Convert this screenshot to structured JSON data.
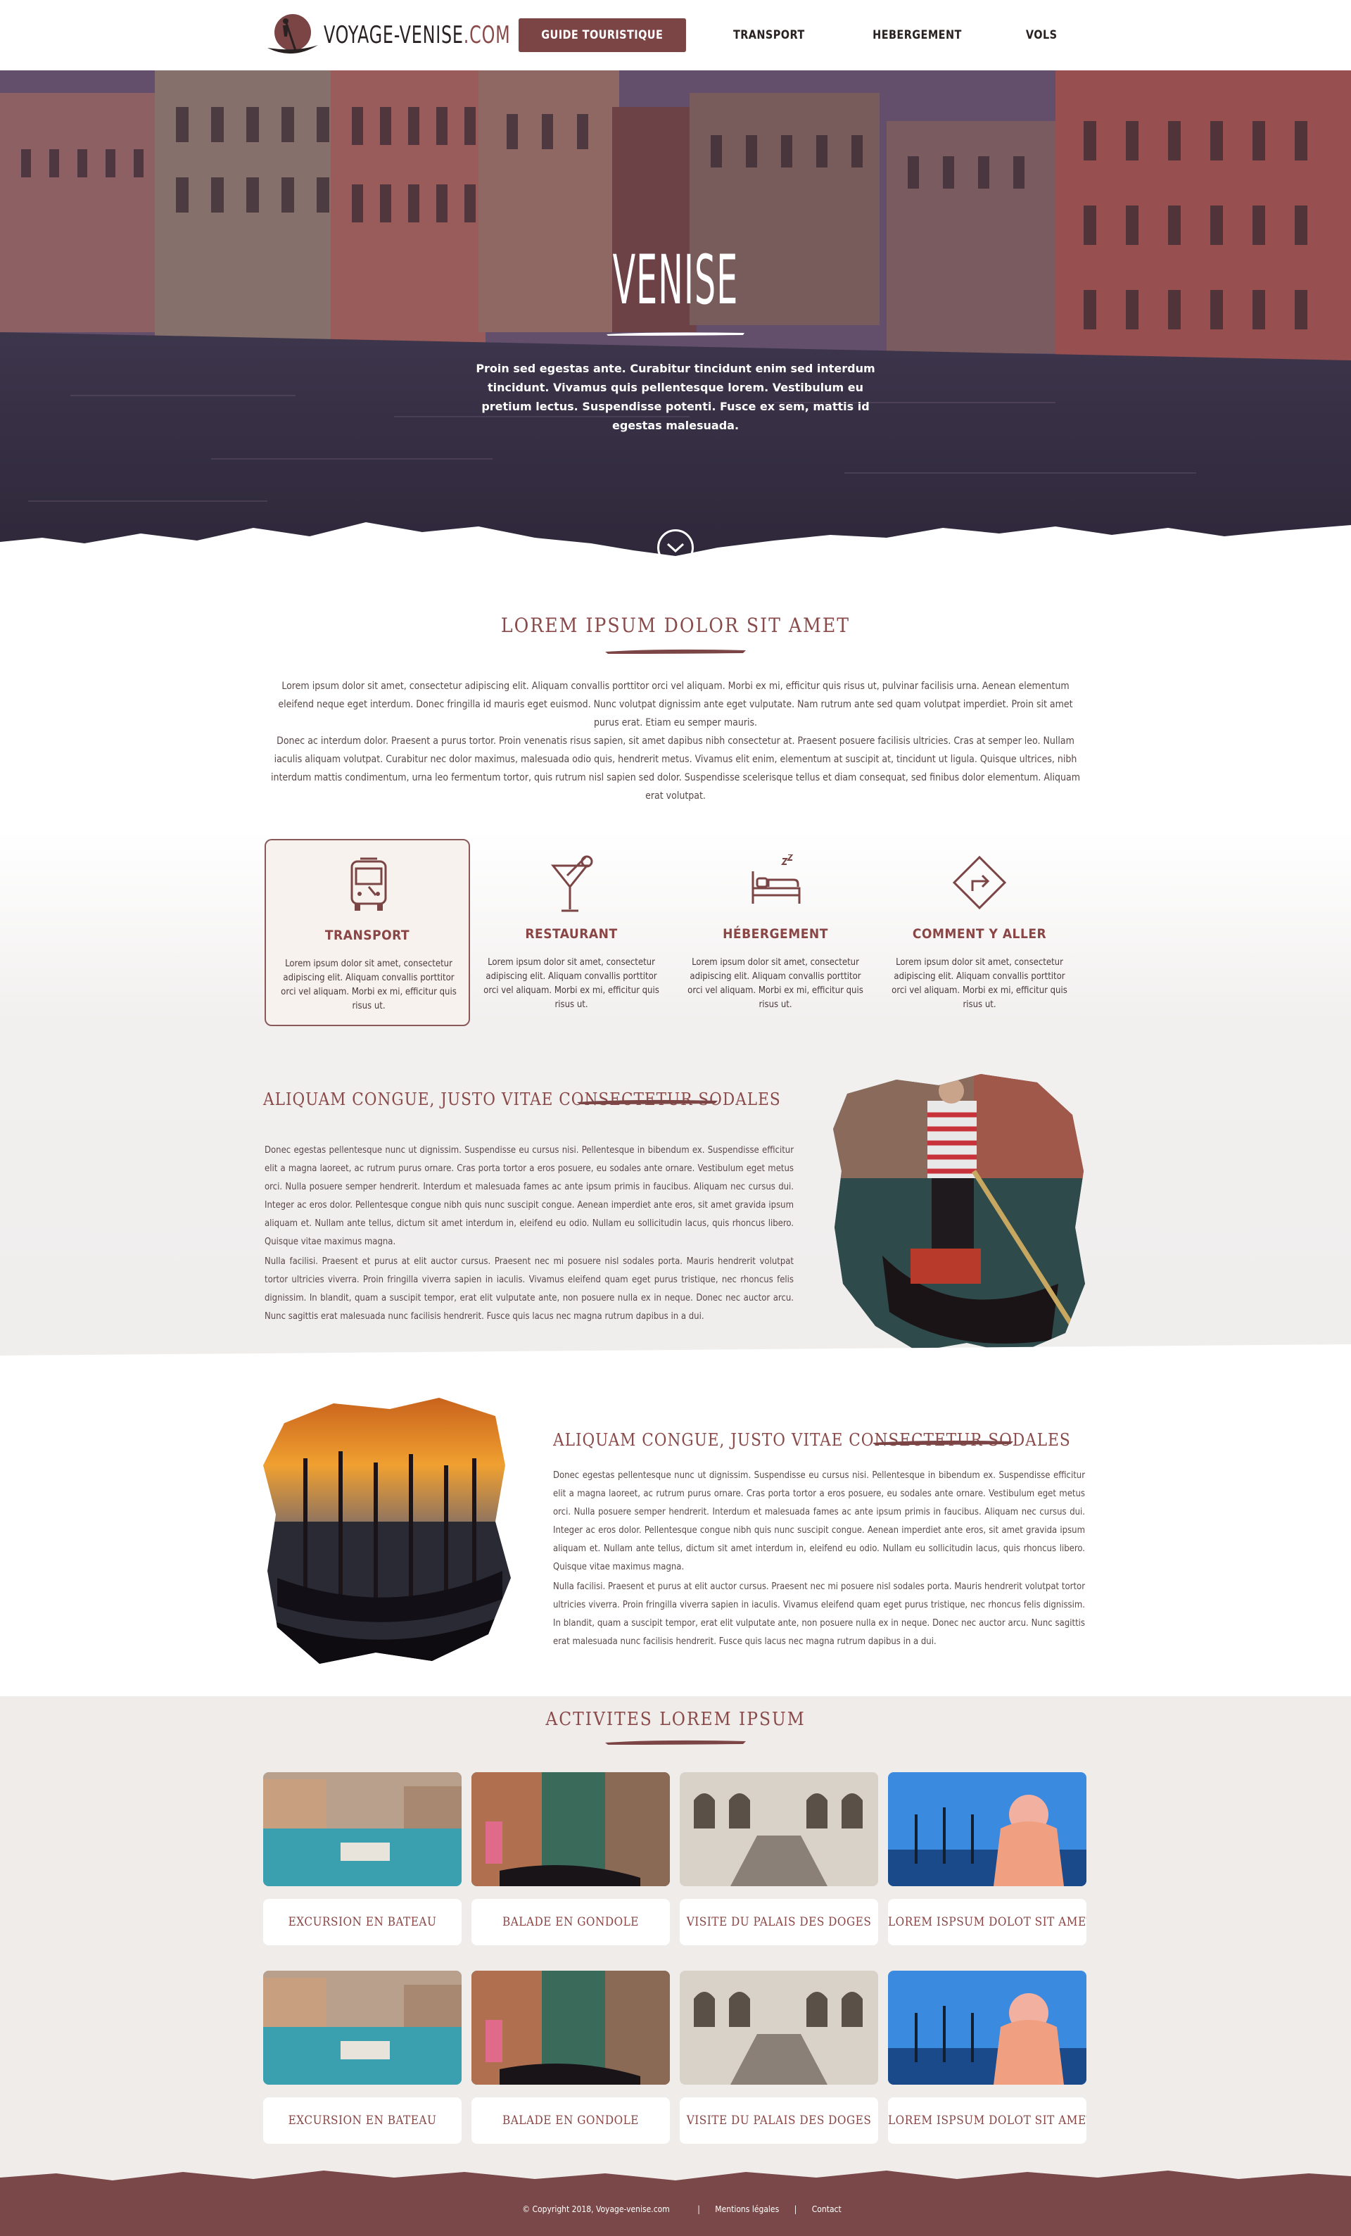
{
  "header": {
    "logo_text": "VOYAGE-VENISE",
    "logo_domain": ".COM",
    "nav": [
      {
        "label": "GUIDE TOURISTIQUE",
        "active": true
      },
      {
        "label": "TRANSPORT",
        "active": false
      },
      {
        "label": "HEBERGEMENT",
        "active": false
      },
      {
        "label": "VOLS",
        "active": false
      }
    ]
  },
  "hero": {
    "title": "VENISE",
    "text": "Proin sed egestas ante. Curabitur tincidunt enim sed interdum tincidunt. Vivamus quis pellentesque lorem. Vestibulum eu pretium lectus. Suspendisse potenti. Fusce ex sem, mattis id egestas malesuada."
  },
  "intro": {
    "title": "Lorem ipsum dolor sit amet",
    "p1": "Lorem ipsum dolor sit amet, consectetur adipiscing elit. Aliquam convallis porttitor orci vel aliquam. Morbi ex mi, efficitur quis risus ut, pulvinar facilisis urna. Aenean elementum eleifend neque eget interdum. Donec fringilla id mauris eget euismod. Nunc volutpat dignissim ante eget vulputate. Nam rutrum ante sed quam volutpat imperdiet. Proin sit amet purus erat. Etiam eu semper mauris.",
    "p2": "Donec ac interdum dolor. Praesent a purus tortor. Proin venenatis risus sapien, sit amet dapibus nibh consectetur at. Praesent posuere facilisis ultricies. Cras at semper leo. Nullam iaculis aliquam volutpat. Curabitur nec dolor maximus, malesuada odio quis, hendrerit metus. Vivamus elit enim, elementum at suscipit at, tincidunt ut ligula. Quisque ultrices, nibh interdum mattis condimentum, urna leo fermentum tortor, quis rutrum nisl sapien sed dolor. Suspendisse scelerisque tellus et diam consequat, sed finibus dolor elementum. Aliquam erat volutpat."
  },
  "services": [
    {
      "title": "TRANSPORT",
      "icon": "bus-icon",
      "active": true,
      "text": "Lorem ipsum dolor sit amet, consectetur adipiscing elit. Aliquam convallis porttitor orci vel aliquam. Morbi ex mi, efficitur quis risus ut."
    },
    {
      "title": "RESTAURANT",
      "icon": "cocktail-icon",
      "active": false,
      "text": "Lorem ipsum dolor sit amet, consectetur adipiscing elit. Aliquam convallis porttitor orci vel aliquam. Morbi ex mi, efficitur quis risus ut."
    },
    {
      "title": "HÉBERGEMENT",
      "icon": "bed-icon",
      "active": false,
      "text": "Lorem ipsum dolor sit amet, consectetur adipiscing elit. Aliquam convallis porttitor orci vel aliquam. Morbi ex mi, efficitur quis risus ut."
    },
    {
      "title": "COMMENT Y ALLER",
      "icon": "directions-icon",
      "active": false,
      "text": "Lorem ipsum dolor sit amet, consectetur adipiscing elit. Aliquam convallis porttitor orci vel aliquam. Morbi ex mi, efficitur quis risus ut."
    }
  ],
  "feature1": {
    "title": "Aliquam congue, justo vitae consectetur sodales",
    "p1": "Donec egestas pellentesque nunc ut dignissim. Suspendisse eu cursus nisi. Pellentesque in bibendum ex. Suspendisse efficitur elit a magna laoreet, ac rutrum purus ornare. Cras porta tortor a eros posuere, eu sodales ante ornare. Vestibulum eget metus orci. Nulla posuere semper hendrerit. Interdum et malesuada fames ac ante ipsum primis in faucibus. Aliquam nec cursus dui. Integer ac eros dolor. Pellentesque congue nibh quis nunc suscipit congue. Aenean imperdiet ante eros, sit amet gravida ipsum aliquam et. Nullam ante tellus, dictum sit amet interdum in, eleifend eu odio. Nullam eu sollicitudin lacus, quis rhoncus libero. Quisque vitae maximus magna.",
    "p2": "Nulla facilisi. Praesent et purus at elit auctor cursus. Praesent nec mi posuere nisl sodales porta. Mauris hendrerit volutpat tortor ultricies viverra. Proin fringilla viverra sapien in iaculis. Vivamus eleifend quam eget purus tristique, nec rhoncus felis dignissim. In blandit, quam a suscipit tempor, erat elit vulputate ante, non posuere nulla ex in neque. Donec nec auctor arcu. Nunc sagittis erat malesuada nunc facilisis hendrerit. Fusce quis lacus nec magna rutrum dapibus in a dui."
  },
  "feature2": {
    "title": "Aliquam congue, justo vitae consectetur sodales",
    "p1": "Donec egestas pellentesque nunc ut dignissim. Suspendisse eu cursus nisi. Pellentesque in bibendum ex. Suspendisse efficitur elit a magna laoreet, ac rutrum purus ornare. Cras porta tortor a eros posuere, eu sodales ante ornare. Vestibulum eget metus orci. Nulla posuere semper hendrerit. Interdum et malesuada fames ac ante ipsum primis in faucibus. Aliquam nec cursus dui. Integer ac eros dolor. Pellentesque congue nibh quis nunc suscipit congue. Aenean imperdiet ante eros, sit amet gravida ipsum aliquam et. Nullam ante tellus, dictum sit amet interdum in, eleifend eu odio. Nullam eu sollicitudin lacus, quis rhoncus libero. Quisque vitae maximus magna.",
    "p2": "Nulla facilisi. Praesent et purus at elit auctor cursus. Praesent nec mi posuere nisl sodales porta. Mauris hendrerit volutpat tortor ultricies viverra. Proin fringilla viverra sapien in iaculis. Vivamus eleifend quam eget purus tristique, nec rhoncus felis dignissim. In blandit, quam a suscipit tempor, erat elit vulputate ante, non posuere nulla ex in neque. Donec nec auctor arcu. Nunc sagittis erat malesuada nunc facilisis hendrerit. Fusce quis lacus nec magna rutrum dapibus in a dui."
  },
  "activities": {
    "title": "Activites lorem ipsum",
    "rows": [
      [
        {
          "label": "Excursion en bateau",
          "scene": "canal"
        },
        {
          "label": "Balade en gondole",
          "scene": "gondola"
        },
        {
          "label": "Visite du palais des doges",
          "scene": "palace"
        },
        {
          "label": "Lorem ispsum dolot sit amet",
          "scene": "carnival"
        }
      ],
      [
        {
          "label": "Excursion en bateau",
          "scene": "canal"
        },
        {
          "label": "Balade en gondole",
          "scene": "gondola"
        },
        {
          "label": "Visite du palais des doges",
          "scene": "palace"
        },
        {
          "label": "Lorem ispsum dolot sit amet",
          "scene": "carnival"
        }
      ]
    ]
  },
  "footer": {
    "copyright": "©   Copyright 2018, Voyage-venise.com",
    "legal": "Mentions légales",
    "contact": "Contact",
    "separator": "|"
  },
  "colors": {
    "accent": "#7b4545",
    "title": "#8a4a4a",
    "footer": "#7a4848"
  }
}
